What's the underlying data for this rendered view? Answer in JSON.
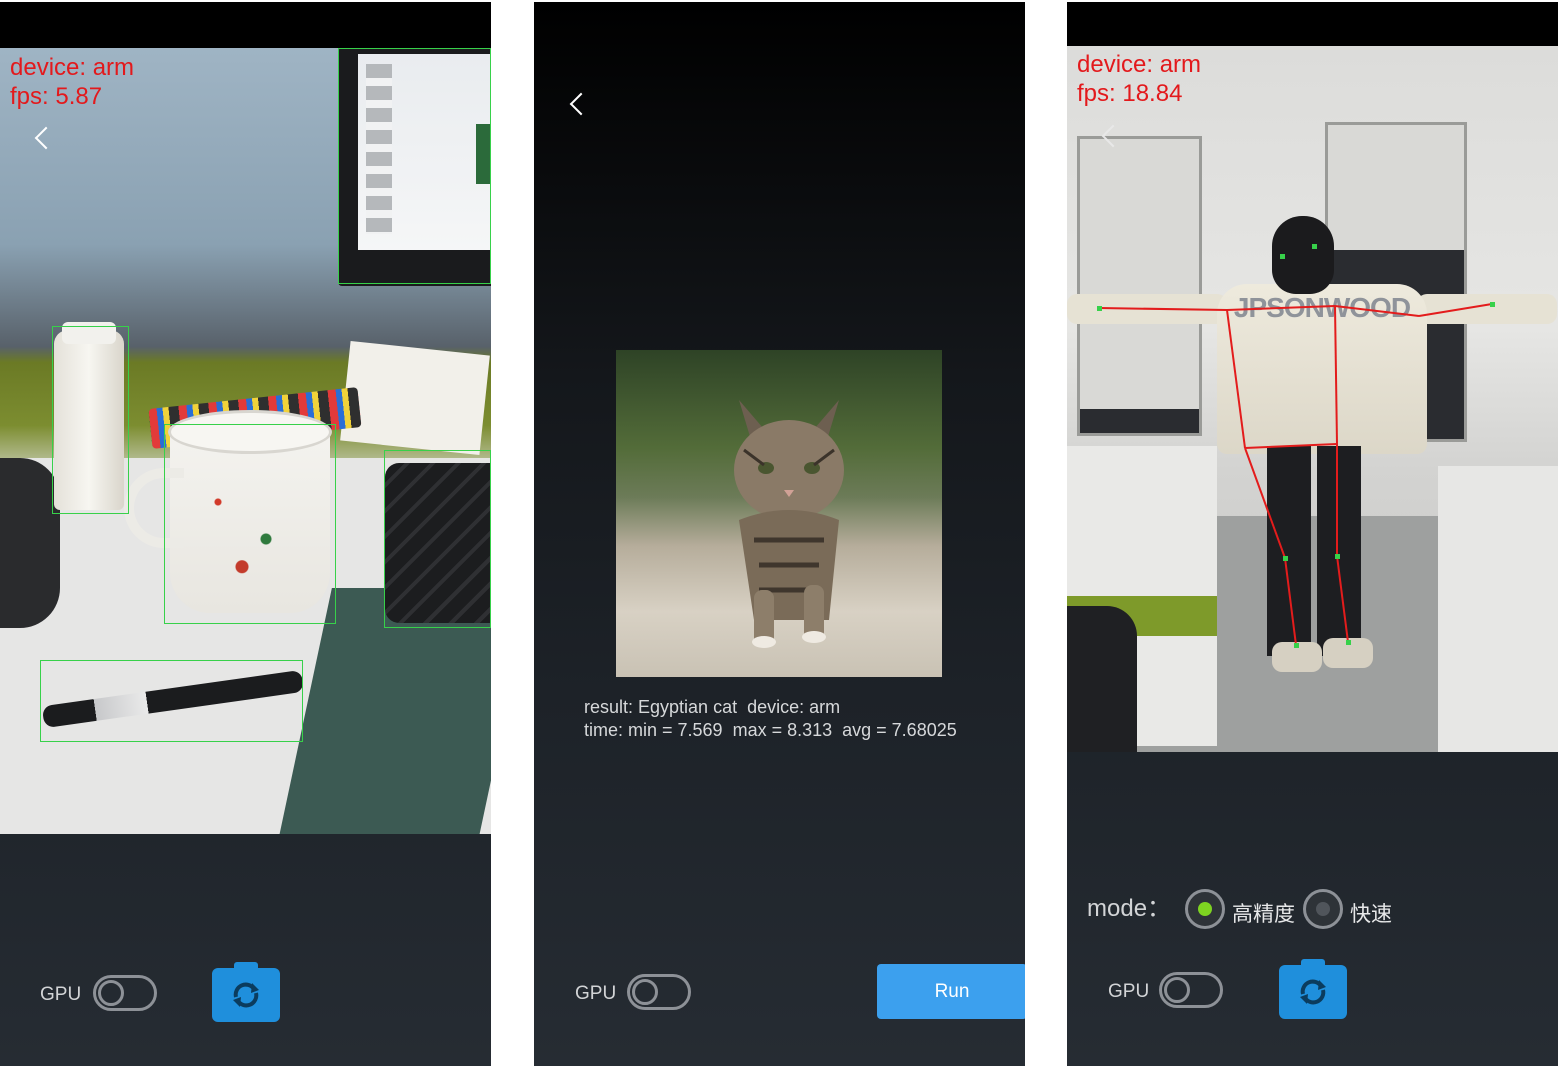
{
  "screens": [
    {
      "device_text": "device: arm",
      "fps_text": "fps: 5.87",
      "gpu_label": "GPU",
      "gpu_enabled": false
    },
    {
      "result_line1": "result: Egyptian cat  device: arm",
      "result_line2": "time: min = 7.569  max = 8.313  avg = 7.68025",
      "gpu_label": "GPU",
      "gpu_enabled": false,
      "run_label": "Run"
    },
    {
      "device_text": "device: arm",
      "fps_text": "fps: 18.84",
      "mode_label": "mode：",
      "mode_options": [
        {
          "label": "高精度",
          "selected": true
        },
        {
          "label": "快速",
          "selected": false
        }
      ],
      "jacket_print": "JPSONWOOD",
      "gpu_label": "GPU",
      "gpu_enabled": false
    }
  ],
  "colors": {
    "overlay_text": "#e3191c",
    "detection_box": "#37d14a",
    "accent_button": "#1f8fdc",
    "run_button": "#3ca0ee",
    "radio_selected": "#7ed321",
    "pose_skeleton": "#e31c1c"
  },
  "icons": {
    "back": "chevron-left-icon",
    "switch_camera": "camera-switch-icon"
  }
}
